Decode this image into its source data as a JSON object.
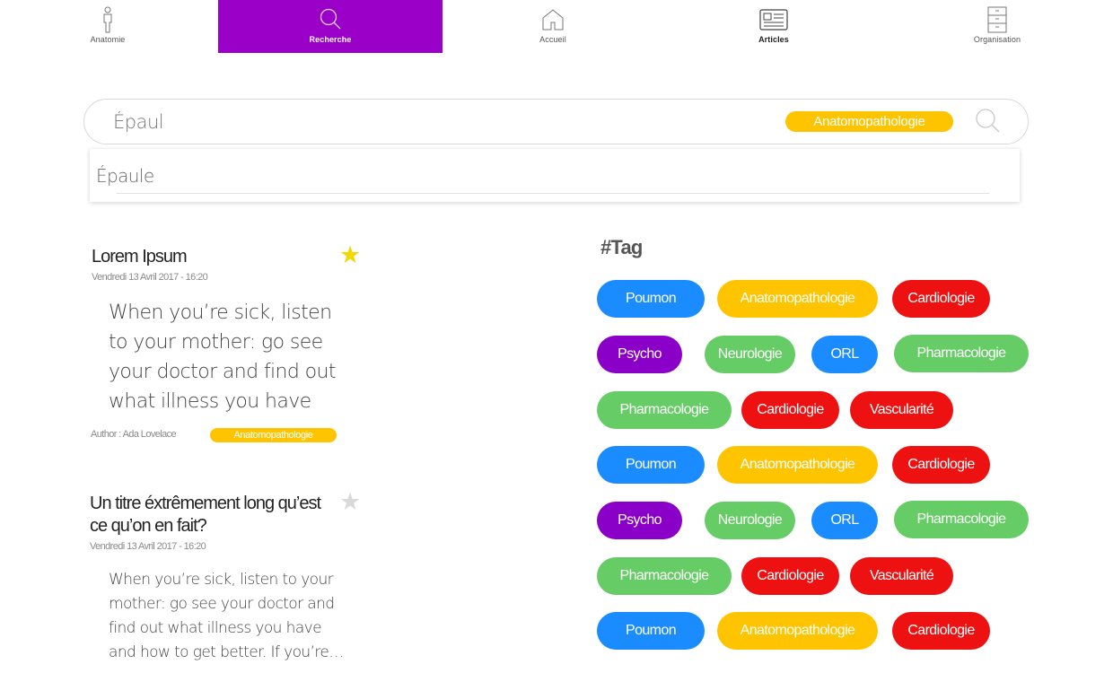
{
  "nav": [
    {
      "label": "Anatomie",
      "icon": "body-icon"
    },
    {
      "label": "Recherche",
      "icon": "search-icon"
    },
    {
      "label": "Accueil",
      "icon": "home-icon"
    },
    {
      "label": "Articles",
      "icon": "newspaper-icon"
    },
    {
      "label": "Organisation",
      "icon": "cabinet-icon"
    }
  ],
  "colors": {
    "accent": "#9a00c8",
    "yellow": "#ffc400",
    "blue": "#1a8cff",
    "purple": "#8a00c8",
    "green": "#66cc66",
    "red": "#ee1111"
  },
  "search": {
    "value": "Épaul",
    "filter": "Anatomopathologie",
    "suggestion": "Épaule"
  },
  "articles": [
    {
      "title": "Lorem Ipsum",
      "date": "Vendredi 13 Avril 2017 - 16:20",
      "body": "When you’re sick, listen to your mother: go see your doctor and find out what illness you have and how to",
      "author": "Author : Ada Lovelace",
      "tag": "Anatomopathologie",
      "starred": true
    },
    {
      "title": "Un titre éxtrêmement long qu’est ce qu’on en fait?",
      "date": "Vendredi 13 Avril 2017 - 16:20",
      "body": "When you’re sick, listen to your mother: go see your doctor and find out what illness you have and how to get better. If you’re…",
      "starred": false
    }
  ],
  "tags": {
    "heading": "#Tag",
    "items": [
      {
        "label": "Poumon",
        "color": "blue"
      },
      {
        "label": "Anatomopathologie",
        "color": "yellow"
      },
      {
        "label": "Cardiologie",
        "color": "red"
      },
      {
        "label": "Psycho",
        "color": "purple"
      },
      {
        "label": "Neurologie",
        "color": "green"
      },
      {
        "label": "ORL",
        "color": "blue"
      },
      {
        "label": "Pharmacologie",
        "color": "green"
      },
      {
        "label": "Pharmacologie",
        "color": "green"
      },
      {
        "label": "Cardiologie",
        "color": "red"
      },
      {
        "label": "Vascularité",
        "color": "red"
      },
      {
        "label": "Poumon",
        "color": "blue"
      },
      {
        "label": "Anatomopathologie",
        "color": "yellow"
      },
      {
        "label": "Cardiologie",
        "color": "red"
      },
      {
        "label": "Psycho",
        "color": "purple"
      },
      {
        "label": "Neurologie",
        "color": "green"
      },
      {
        "label": "ORL",
        "color": "blue"
      },
      {
        "label": "Pharmacologie",
        "color": "green"
      },
      {
        "label": "Pharmacologie",
        "color": "green"
      },
      {
        "label": "Cardiologie",
        "color": "red"
      },
      {
        "label": "Vascularité",
        "color": "red"
      },
      {
        "label": "Poumon",
        "color": "blue"
      },
      {
        "label": "Anatomopathologie",
        "color": "yellow"
      },
      {
        "label": "Cardiologie",
        "color": "red"
      }
    ]
  }
}
